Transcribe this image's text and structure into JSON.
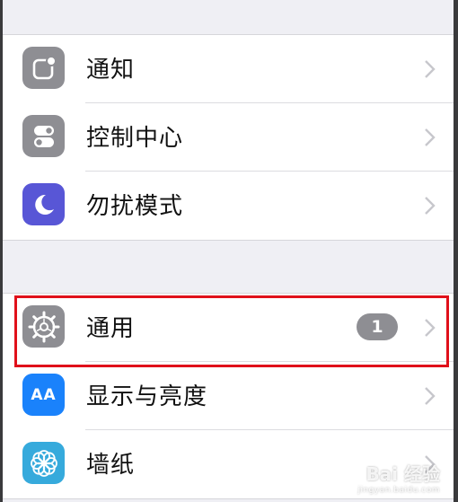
{
  "settings": {
    "group1": [
      {
        "label": "通知",
        "icon": "notification-icon",
        "color": "#8e8e93"
      },
      {
        "label": "控制中心",
        "icon": "control-center-icon",
        "color": "#8e8e93"
      },
      {
        "label": "勿扰模式",
        "icon": "moon-icon",
        "color": "#5856d6"
      }
    ],
    "group2": [
      {
        "label": "通用",
        "icon": "gear-icon",
        "color": "#8e8e93",
        "badge": "1"
      },
      {
        "label": "显示与亮度",
        "icon": "text-size-icon",
        "color": "#1a82fb",
        "icon_text": "AA"
      },
      {
        "label": "墙纸",
        "icon": "flower-icon",
        "color": "#36aadc"
      }
    ]
  },
  "watermark": {
    "text": "Bai 经验",
    "sub": "jingyan.baidu.com"
  },
  "highlight_color": "#e0101a"
}
